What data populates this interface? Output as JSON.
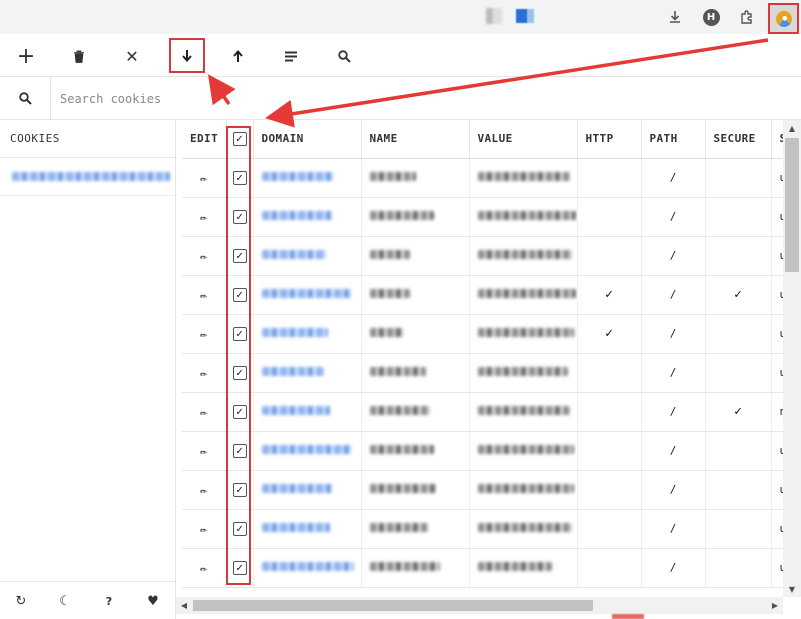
{
  "browser": {
    "icons": [
      "download-icon",
      "profile-h-icon",
      "puzzle-icon",
      "cookie-extension-icon"
    ],
    "profile_letter": "H"
  },
  "toolbar": {
    "tools": [
      {
        "icon": "plus-icon",
        "glyph": "+"
      },
      {
        "icon": "trash-icon",
        "glyph": "🗑"
      },
      {
        "icon": "close-icon",
        "glyph": "✕"
      },
      {
        "icon": "export-download-icon",
        "glyph": "🡇"
      },
      {
        "icon": "import-upload-icon",
        "glyph": "🡅"
      },
      {
        "icon": "list-icon",
        "glyph": "≡"
      },
      {
        "icon": "search-icon",
        "glyph": "⚲"
      }
    ]
  },
  "search": {
    "placeholder": "Search cookies",
    "value": ""
  },
  "sidebar": {
    "header": "COOKIES",
    "footer_icons": [
      {
        "icon": "refresh-icon",
        "glyph": "↻"
      },
      {
        "icon": "moon-icon",
        "glyph": "☾"
      },
      {
        "icon": "help-icon",
        "glyph": "?"
      },
      {
        "icon": "heart-icon",
        "glyph": "♥"
      }
    ]
  },
  "table": {
    "columns": [
      "EDIT",
      "",
      "DOMAIN",
      "NAME",
      "VALUE",
      "HTTP",
      "PATH",
      "SECURE",
      "S"
    ],
    "header_checked": true,
    "rows": [
      {
        "checked": true,
        "http": "",
        "path": "/",
        "secure": "",
        "s": "u"
      },
      {
        "checked": true,
        "http": "",
        "path": "/",
        "secure": "",
        "s": "u"
      },
      {
        "checked": true,
        "http": "",
        "path": "/",
        "secure": "",
        "s": "u"
      },
      {
        "checked": true,
        "http": "✓",
        "path": "/",
        "secure": "✓",
        "s": "u"
      },
      {
        "checked": true,
        "http": "✓",
        "path": "/",
        "secure": "",
        "s": "u"
      },
      {
        "checked": true,
        "http": "",
        "path": "/",
        "secure": "",
        "s": "u"
      },
      {
        "checked": true,
        "http": "",
        "path": "/",
        "secure": "✓",
        "s": "n"
      },
      {
        "checked": true,
        "http": "",
        "path": "/",
        "secure": "",
        "s": "u"
      },
      {
        "checked": true,
        "http": "",
        "path": "/",
        "secure": "",
        "s": "u"
      },
      {
        "checked": true,
        "http": "",
        "path": "/",
        "secure": "",
        "s": "u"
      },
      {
        "checked": true,
        "http": "",
        "path": "/",
        "secure": "",
        "s": "u"
      }
    ]
  },
  "colors": {
    "highlight": "#d43a3a",
    "arrow": "#e53935"
  }
}
